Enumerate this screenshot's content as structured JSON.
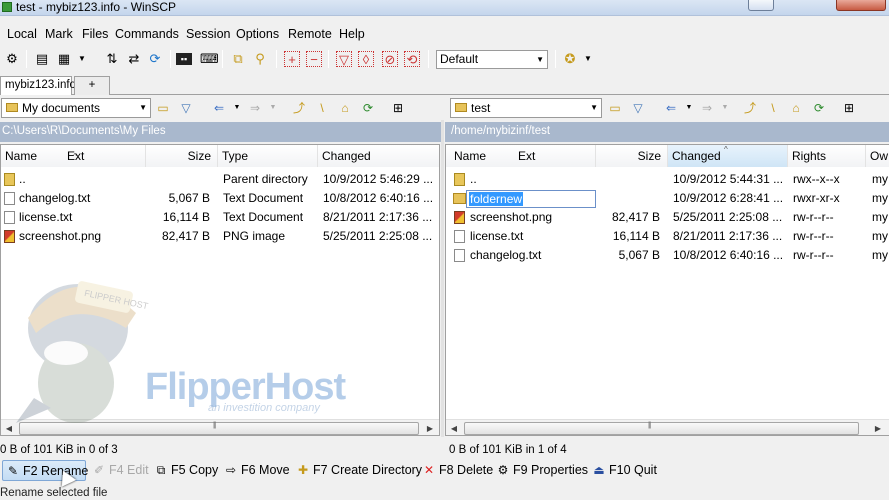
{
  "window": {
    "title": "test - mybiz123.info - WinSCP",
    "minimize_icon": "minimize-icon",
    "close_icon": "close-icon"
  },
  "menu": [
    {
      "label": "Local"
    },
    {
      "label": "Mark"
    },
    {
      "label": "Files"
    },
    {
      "label": "Commands"
    },
    {
      "label": "Session"
    },
    {
      "label": "Options"
    },
    {
      "label": "Remote"
    },
    {
      "label": "Help"
    }
  ],
  "toolbar": {
    "transfer_settings": "Default"
  },
  "session_tabs": {
    "active": "mybiz123.info",
    "new_tab": "+"
  },
  "left_panel": {
    "location": "My documents",
    "path": "C:\\Users\\R\\Documents\\My Files",
    "columns": [
      "Name",
      "Ext",
      "Size",
      "Type",
      "Changed"
    ],
    "rows": [
      {
        "name": "..",
        "size": "",
        "type": "Parent directory",
        "changed": "10/9/2012  5:46:29 ...",
        "icon": "parent-folder-icon"
      },
      {
        "name": "changelog.txt",
        "size": "5,067 B",
        "type": "Text Document",
        "changed": "10/8/2012  6:40:16 ...",
        "icon": "text-file-icon"
      },
      {
        "name": "license.txt",
        "size": "16,114 B",
        "type": "Text Document",
        "changed": "8/21/2011  2:17:36 ...",
        "icon": "text-file-icon"
      },
      {
        "name": "screenshot.png",
        "size": "82,417 B",
        "type": "PNG image",
        "changed": "5/25/2011  2:25:08 ...",
        "icon": "image-file-icon"
      }
    ],
    "status": "0 B of 101 KiB in 0 of 3"
  },
  "right_panel": {
    "location": "test",
    "path": "/home/mybizinf/test",
    "columns": [
      "Name",
      "Ext",
      "Size",
      "Changed",
      "Rights",
      "Ow"
    ],
    "rows": [
      {
        "name": "..",
        "size": "",
        "changed": "10/9/2012  5:44:31 ...",
        "rights": "rwx--x--x",
        "owner": "my",
        "icon": "parent-folder-icon"
      },
      {
        "name": "foldernew",
        "size": "",
        "changed": "10/9/2012  6:28:41 ...",
        "rights": "rwxr-xr-x",
        "owner": "my",
        "icon": "folder-icon",
        "editing": true
      },
      {
        "name": "screenshot.png",
        "size": "82,417 B",
        "changed": "5/25/2011  2:25:08 ...",
        "rights": "rw-r--r--",
        "owner": "my",
        "icon": "image-file-icon"
      },
      {
        "name": "license.txt",
        "size": "16,114 B",
        "changed": "8/21/2011  2:17:36 ...",
        "rights": "rw-r--r--",
        "owner": "my",
        "icon": "text-file-icon"
      },
      {
        "name": "changelog.txt",
        "size": "5,067 B",
        "changed": "10/8/2012  6:40:16 ...",
        "rights": "rw-r--r--",
        "owner": "my",
        "icon": "text-file-icon"
      }
    ],
    "status": "0 B of 101 KiB in 1 of 4"
  },
  "commands": {
    "rename": "F2 Rename",
    "edit": "F4 Edit",
    "copy": "F5 Copy",
    "move": "F6 Move",
    "create_dir": "F7 Create Directory",
    "delete": "F8 Delete",
    "properties": "F9 Properties",
    "quit": "F10 Quit"
  },
  "hint": "Rename selected file",
  "watermark": {
    "brand": "FlipperHost",
    "tagline": "an investition company",
    "cap_text": "FLIPPER HOST"
  },
  "colors": {
    "selection": "#3399ff",
    "path_bar": "#a9b8cd",
    "watermark": "#7aa6d8"
  }
}
